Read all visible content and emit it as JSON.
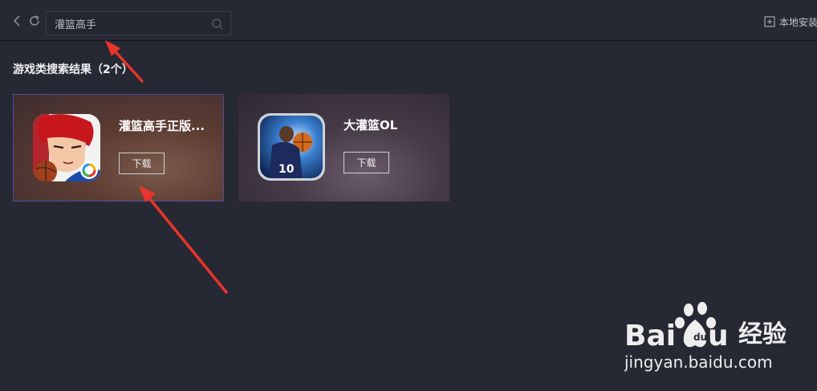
{
  "toolbar": {
    "back_icon": "chevron-left-icon",
    "refresh_icon": "refresh-icon",
    "search": {
      "value": "灌篮高手",
      "icon": "search-icon"
    },
    "local_install": {
      "label": "本地安装",
      "icon": "folder-plus-icon"
    }
  },
  "results": {
    "title": "游戏类搜索结果（2个）",
    "items": [
      {
        "name": "灌篮高手正版...",
        "button": "下载",
        "icon": "anime-basketball-player-icon"
      },
      {
        "name": "大灌篮OL",
        "button": "下载",
        "icon": "basketball-player-10-icon"
      }
    ]
  },
  "watermark": {
    "brand": "Baidu",
    "brand_cn": "经验",
    "url": "jingyan.baidu.com"
  },
  "colors": {
    "background": "#262833",
    "annotation_arrow": "#e8352b",
    "selected_border": "#4e4fa0",
    "watermark": "#ffffff"
  }
}
